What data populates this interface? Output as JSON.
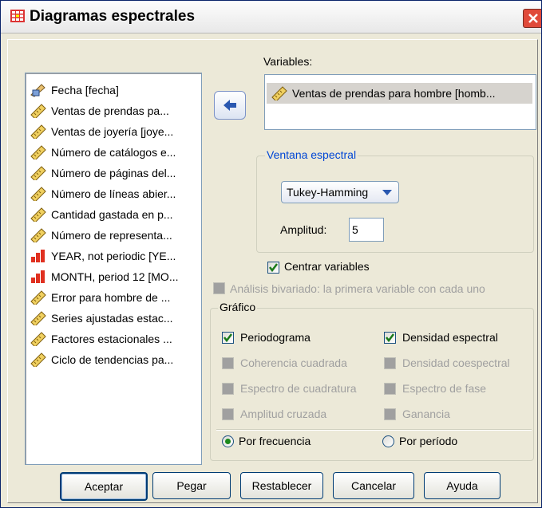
{
  "window": {
    "title": "Diagramas espectrales",
    "icon": "table-icon"
  },
  "source_list": {
    "items": [
      {
        "label": "Fecha [fecha]",
        "icon": "date-icon"
      },
      {
        "label": "Ventas de prendas pa...",
        "icon": "ruler-icon"
      },
      {
        "label": "Ventas de joyería [joye...",
        "icon": "ruler-icon"
      },
      {
        "label": "Número de catálogos e...",
        "icon": "ruler-icon"
      },
      {
        "label": "Número de páginas del...",
        "icon": "ruler-icon"
      },
      {
        "label": "Número de líneas abier...",
        "icon": "ruler-icon"
      },
      {
        "label": "Cantidad gastada en p...",
        "icon": "ruler-icon"
      },
      {
        "label": "Número de representa...",
        "icon": "ruler-icon"
      },
      {
        "label": "YEAR, not periodic [YE...",
        "icon": "ordinal-icon"
      },
      {
        "label": "MONTH, period 12 [MO...",
        "icon": "ordinal-icon"
      },
      {
        "label": "Error para hombre de ...",
        "icon": "ruler-icon"
      },
      {
        "label": "Series ajustadas estac...",
        "icon": "ruler-icon"
      },
      {
        "label": "Factores estacionales ...",
        "icon": "ruler-icon"
      },
      {
        "label": "Ciclo de tendencias pa...",
        "icon": "ruler-icon"
      }
    ]
  },
  "variables": {
    "label": "Variables:",
    "items": [
      {
        "label": "Ventas de prendas para hombre [homb...",
        "icon": "ruler-icon"
      }
    ]
  },
  "spectral_window": {
    "legend": "Ventana espectral",
    "selected": "Tukey-Hamming",
    "amplitude_label": "Amplitud:",
    "amplitude_value": "5"
  },
  "center_variables": {
    "label": "Centrar variables",
    "checked": true
  },
  "bivariate": {
    "label": "Análisis bivariado: la primera variable con cada uno",
    "checked": false,
    "enabled": false
  },
  "plot": {
    "legend": "Gráfico",
    "periodogram": {
      "label": "Periodograma",
      "checked": true
    },
    "spectral_density": {
      "label": "Densidad espectral",
      "checked": true
    },
    "squared_coherency": {
      "label": "Coherencia cuadrada",
      "enabled": false
    },
    "cospectral_density": {
      "label": "Densidad coespectral",
      "enabled": false
    },
    "quadrature_spectrum": {
      "label": "Espectro de cuadratura",
      "enabled": false
    },
    "phase_spectrum": {
      "label": "Espectro de fase",
      "enabled": false
    },
    "cross_amplitude": {
      "label": "Amplitud cruzada",
      "enabled": false
    },
    "gain": {
      "label": "Ganancia",
      "enabled": false
    },
    "by_frequency": {
      "label": "Por frecuencia",
      "selected": true
    },
    "by_period": {
      "label": "Por período",
      "selected": false
    }
  },
  "buttons": {
    "ok": "Aceptar",
    "paste": "Pegar",
    "reset": "Restablecer",
    "cancel": "Cancelar",
    "help": "Ayuda"
  }
}
